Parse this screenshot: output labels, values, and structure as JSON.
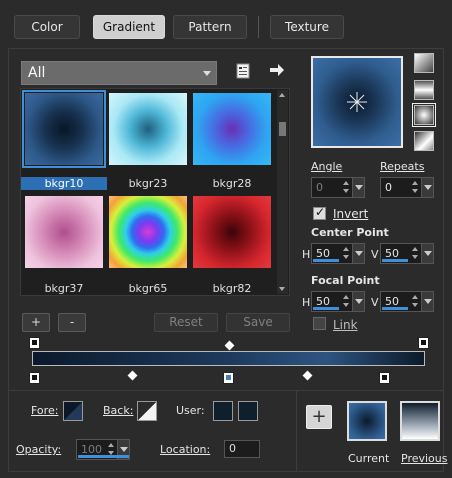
{
  "tabs": [
    {
      "label": "Color"
    },
    {
      "label": "Gradient",
      "active": true
    },
    {
      "label": "Pattern"
    },
    {
      "label": "Texture"
    }
  ],
  "category": {
    "selected": "All"
  },
  "gallery": {
    "items": [
      {
        "label": "bkgr10",
        "selected": true
      },
      {
        "label": "bkgr23"
      },
      {
        "label": "bkgr28"
      },
      {
        "label": "bkgr37"
      },
      {
        "label": "bkgr65"
      },
      {
        "label": "bkgr82"
      }
    ]
  },
  "buttons": {
    "add": "+",
    "remove": "-",
    "reset": "Reset",
    "save": "Save"
  },
  "angle": {
    "label": "Angle",
    "value": "0"
  },
  "repeats": {
    "label": "Repeats",
    "value": "0"
  },
  "invert": {
    "label": "Invert",
    "checked": true
  },
  "center_point": {
    "label": "Center Point",
    "h_label": "H",
    "h": "50",
    "v_label": "V",
    "v": "50"
  },
  "focal_point": {
    "label": "Focal Point",
    "h_label": "H",
    "h": "50",
    "v_label": "V",
    "v": "50"
  },
  "link": {
    "label": "Link",
    "checked": false
  },
  "bottom": {
    "fore_label": "Fore:",
    "back_label": "Back:",
    "user_label": "User:",
    "opacity_label": "Opacity:",
    "opacity_value": "100",
    "location_label": "Location:",
    "location_value": "0",
    "current_label": "Current",
    "previous_label": "Previous",
    "plus": "+"
  },
  "colors": {
    "accent": "#3f8fd9",
    "active_tab": "#cfcfcf",
    "background": "#2b2b2b"
  }
}
